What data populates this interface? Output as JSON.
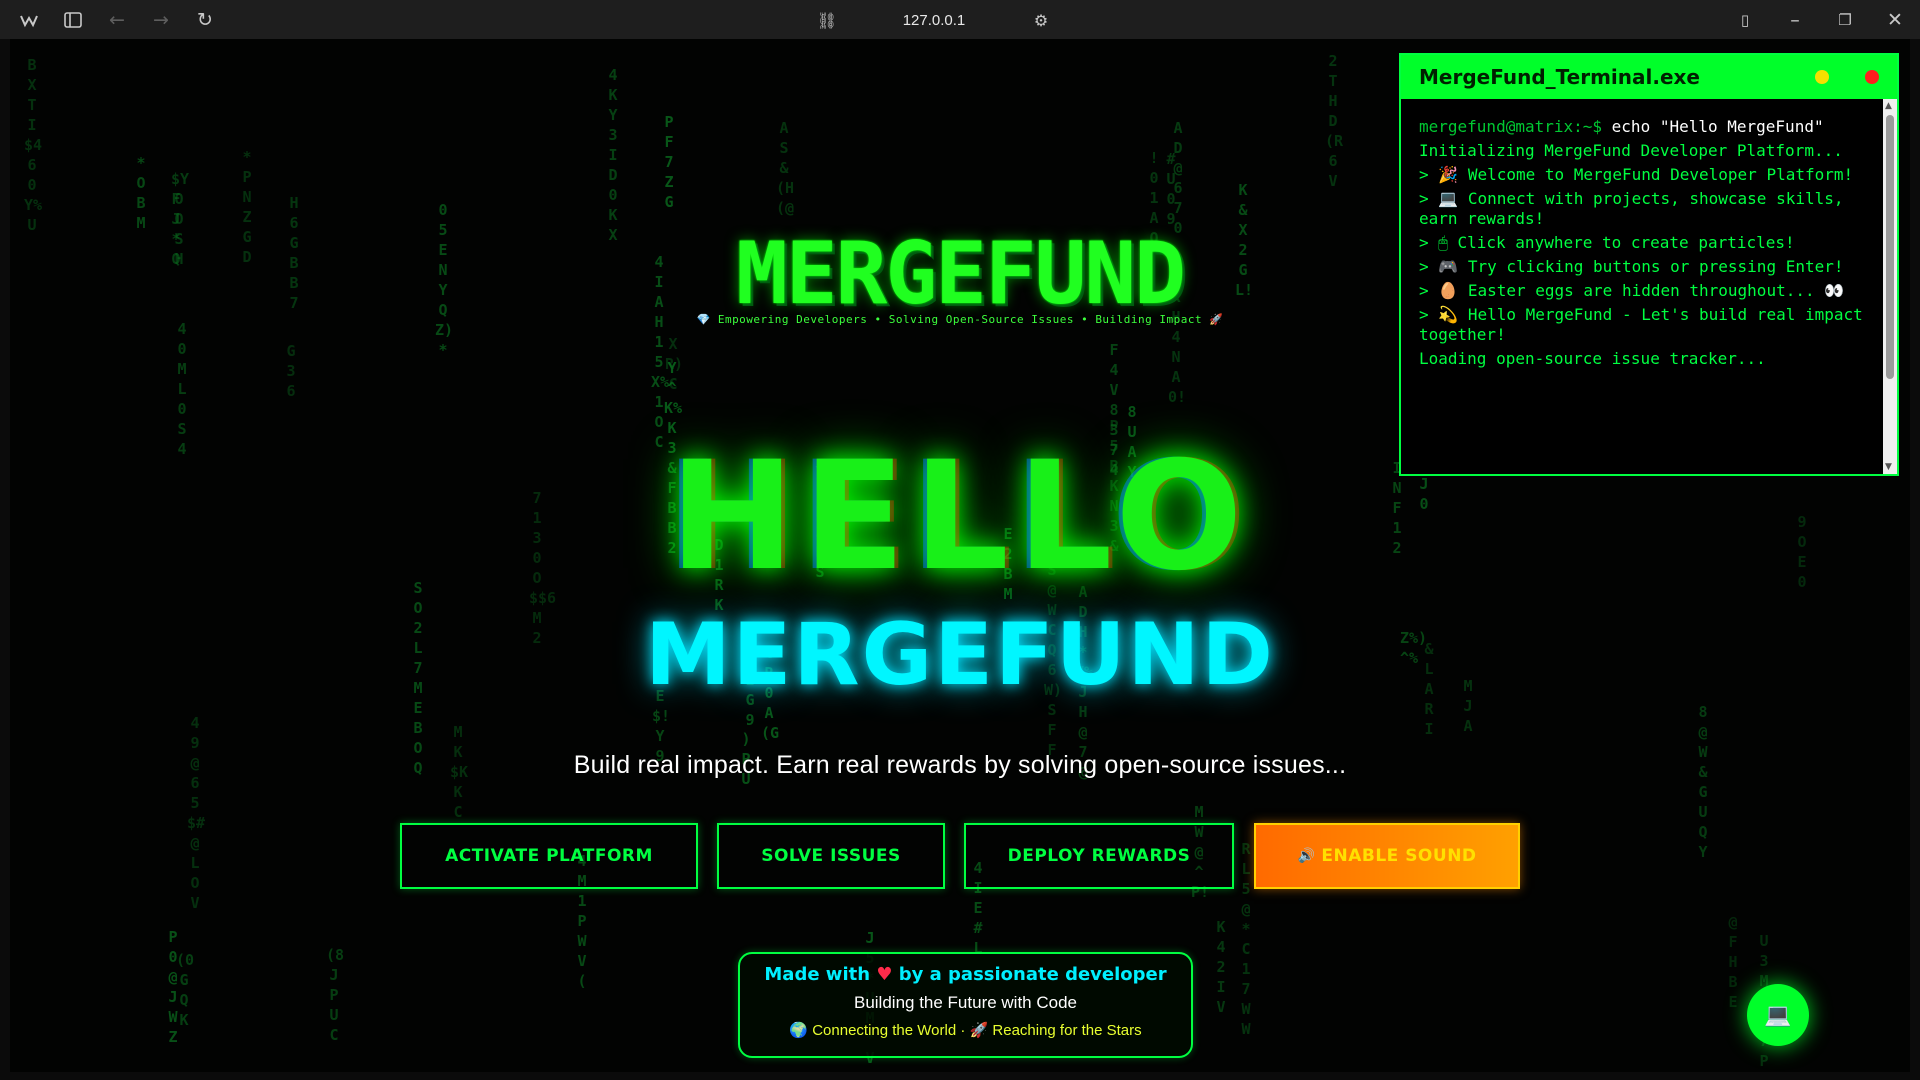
{
  "browser": {
    "url": "127.0.0.1",
    "icons": [
      "app-logo-icon",
      "sidebar-icon",
      "back-icon",
      "forward-icon",
      "reload-icon",
      "link-icon",
      "site-settings-icon",
      "split-view-icon",
      "minimize-icon",
      "restore-icon",
      "close-icon"
    ]
  },
  "rain_chars": "0123456789ABCDEFGHIJKLMNOPQRSTUVWXYZ@#$%&*^()!",
  "logo": {
    "title": "MERGEFUND",
    "tagline": "💎 Empowering Developers • Solving Open-Source Issues • Building Impact 🚀"
  },
  "hero": {
    "hello": "HELLO",
    "brand": "MERGEFUND",
    "tagline": "Build real impact. Earn real rewards by solving open-source issues..."
  },
  "buttons": {
    "activate": "ACTIVATE PLATFORM",
    "solve": "SOLVE ISSUES",
    "deploy": "DEPLOY REWARDS",
    "sound_icon": "🔊",
    "sound": "ENABLE SOUND"
  },
  "footer": {
    "made_with": "Made with",
    "heart": "♥",
    "by": "by a passionate developer",
    "line2": "Building the Future with Code",
    "globe": "🌍",
    "connect": "Connecting the World",
    "sep": "·",
    "rocket": "🚀",
    "reach": "Reaching for the Stars"
  },
  "terminal": {
    "title": "MergeFund_Terminal.exe",
    "prompt": "mergefund@matrix:~$",
    "command": " echo \"Hello MergeFund\"",
    "lines": [
      "Initializing MergeFund Developer Platform...",
      "> 🎉 Welcome to MergeFund Developer Platform!",
      "> 💻 Connect with projects, showcase skills, earn rewards!",
      "> 🖱 Click anywhere to create particles!",
      "> 🎮 Try clicking buttons or pressing Enter!",
      "> 🥚 Easter eggs are hidden throughout... 👀",
      "> 💫 Hello MergeFund - Let's build real impact together!",
      "Loading open-source issue tracker..."
    ]
  },
  "fab": {
    "icon": "💻"
  },
  "colors": {
    "matrix_green": "#00ff41",
    "cyan": "#00f6ff",
    "orange": "#ff8c00",
    "heart_red": "#ff2b4a"
  }
}
